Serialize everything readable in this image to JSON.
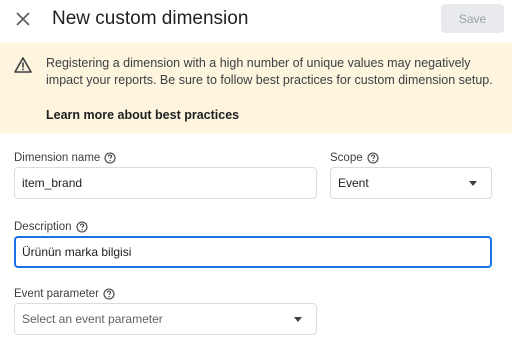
{
  "header": {
    "title": "New custom dimension",
    "save_label": "Save"
  },
  "banner": {
    "message": "Registering a dimension with a high number of unique values may negatively impact your reports. Be sure to follow best practices for custom dimension setup.",
    "link": "Learn more about best practices"
  },
  "form": {
    "dimension_name": {
      "label": "Dimension name",
      "value": "item_brand"
    },
    "scope": {
      "label": "Scope",
      "value": "Event"
    },
    "description": {
      "label": "Description",
      "value": "Ürünün marka bilgisi"
    },
    "event_parameter": {
      "label": "Event parameter",
      "placeholder": "Select an event parameter"
    }
  },
  "colors": {
    "banner_bg": "#fdf5dd",
    "focus_blue": "#1a73e8",
    "disabled_button": "#e8eaed"
  },
  "icons": [
    "close-icon",
    "warning-icon",
    "help-icon",
    "dropdown-arrow-icon"
  ]
}
